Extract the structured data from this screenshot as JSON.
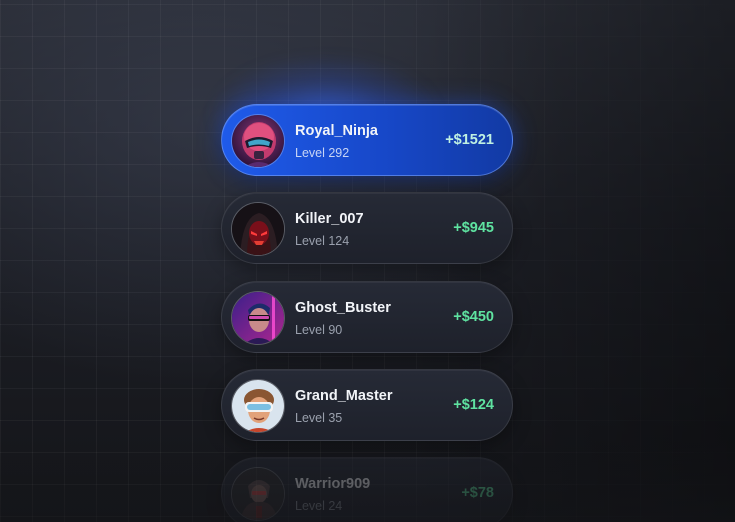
{
  "leaderboard": {
    "players": [
      {
        "name": "Royal_Ninja",
        "level": "Level 292",
        "amount": "+$1521",
        "avatar_icon": "helmet-ninja-avatar"
      },
      {
        "name": "Killer_007",
        "level": "Level 124",
        "amount": "+$945",
        "avatar_icon": "hooded-red-mask-avatar"
      },
      {
        "name": "Ghost_Buster",
        "level": "Level 90",
        "amount": "+$450",
        "avatar_icon": "neon-visor-avatar"
      },
      {
        "name": "Grand_Master",
        "level": "Level 35",
        "amount": "+$124",
        "avatar_icon": "vr-headset-avatar"
      },
      {
        "name": "Warrior909",
        "level": "Level 24",
        "amount": "+$78",
        "avatar_icon": "armored-warrior-avatar"
      }
    ]
  },
  "colors": {
    "active_card": "#1f5bea",
    "card": "#232733",
    "amount_green": "#5fe3a1",
    "background": "#1d1f26"
  }
}
